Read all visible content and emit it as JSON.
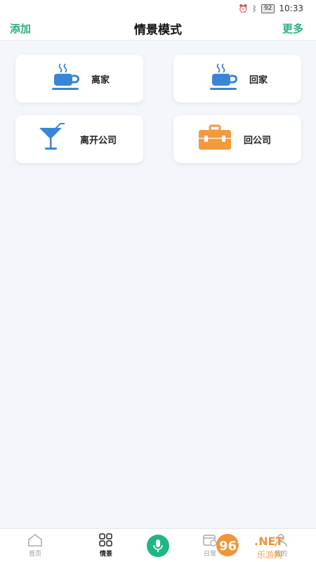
{
  "status_bar": {
    "icons": [
      "alarm-icon",
      "bluetooth-icon"
    ],
    "battery": "92",
    "time": "10:33"
  },
  "header": {
    "left_action": "添加",
    "title": "情景模式",
    "right_action": "更多"
  },
  "scenes": [
    {
      "label": "离家",
      "icon": "coffee-cup-icon",
      "color": "#3a86d6"
    },
    {
      "label": "回家",
      "icon": "coffee-cup-icon",
      "color": "#3a86d6"
    },
    {
      "label": "离开公司",
      "icon": "cocktail-glass-icon",
      "color": "#3a86d6"
    },
    {
      "label": "回公司",
      "icon": "toolbox-icon",
      "color": "#f39a3c"
    }
  ],
  "tabbar": {
    "items": [
      {
        "label": "首页",
        "icon": "home-icon",
        "active": false
      },
      {
        "label": "情景",
        "icon": "grid-icon",
        "active": true
      },
      {
        "label": "",
        "icon": "microphone-icon",
        "active": false
      },
      {
        "label": "日常",
        "icon": "calendar-clock-icon",
        "active": false
      },
      {
        "label": "我的",
        "icon": "user-icon",
        "active": false
      }
    ]
  },
  "watermark": {
    "brand": "962.NET",
    "sub": "乐游网"
  },
  "colors": {
    "accent": "#2db07f",
    "icon_blue": "#3a86d6",
    "icon_orange": "#f39a3c",
    "mic_green": "#1fb683"
  }
}
